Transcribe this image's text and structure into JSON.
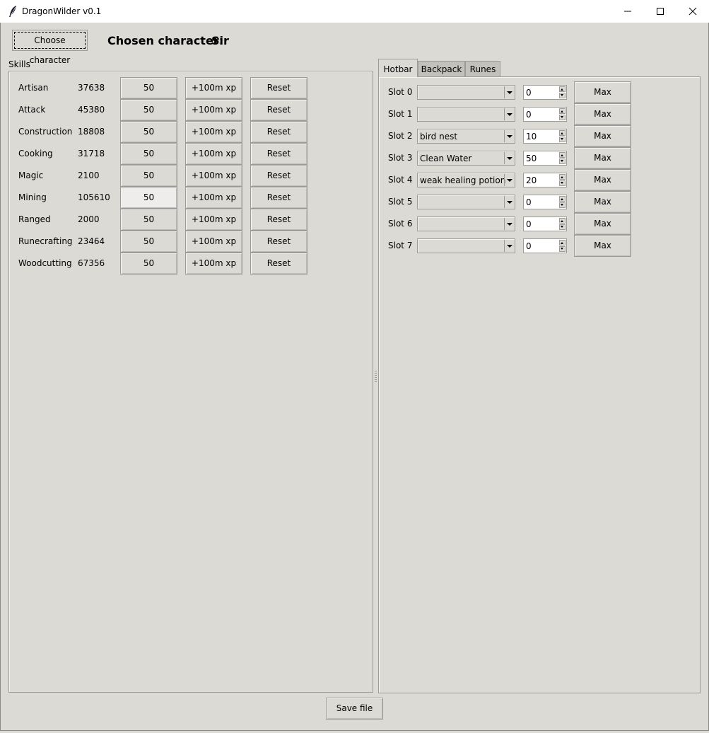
{
  "window": {
    "title": "DragonWilder v0.1",
    "app_icon": "feather-icon",
    "controls": [
      "minimize-icon",
      "maximize-icon",
      "close-icon"
    ]
  },
  "header": {
    "choose_button": "Choose character",
    "chosen_label": "Chosen character:",
    "chosen_value": "Sir"
  },
  "skills": {
    "title": "Skills",
    "rows": [
      {
        "name": "Artisan",
        "xp": "37638",
        "level": "50",
        "add_label": "+100m xp",
        "reset_label": "Reset"
      },
      {
        "name": "Attack",
        "xp": "45380",
        "level": "50",
        "add_label": "+100m xp",
        "reset_label": "Reset"
      },
      {
        "name": "Construction",
        "xp": "18808",
        "level": "50",
        "add_label": "+100m xp",
        "reset_label": "Reset"
      },
      {
        "name": "Cooking",
        "xp": "31718",
        "level": "50",
        "add_label": "+100m xp",
        "reset_label": "Reset"
      },
      {
        "name": "Magic",
        "xp": "2100",
        "level": "50",
        "add_label": "+100m xp",
        "reset_label": "Reset"
      },
      {
        "name": "Mining",
        "xp": "105610",
        "level": "50",
        "add_label": "+100m xp",
        "reset_label": "Reset"
      },
      {
        "name": "Ranged",
        "xp": "2000",
        "level": "50",
        "add_label": "+100m xp",
        "reset_label": "Reset"
      },
      {
        "name": "Runecrafting",
        "xp": "23464",
        "level": "50",
        "add_label": "+100m xp",
        "reset_label": "Reset"
      },
      {
        "name": "Woodcutting",
        "xp": "67356",
        "level": "50",
        "add_label": "+100m xp",
        "reset_label": "Reset"
      }
    ]
  },
  "tabs": [
    {
      "label": "Hotbar",
      "selected": true
    },
    {
      "label": "Backpack",
      "selected": false
    },
    {
      "label": "Runes",
      "selected": false
    }
  ],
  "hotbar": {
    "slots": [
      {
        "label": "Slot 0",
        "item": "",
        "qty": "0",
        "max_label": "Max"
      },
      {
        "label": "Slot 1",
        "item": "",
        "qty": "0",
        "max_label": "Max"
      },
      {
        "label": "Slot 2",
        "item": "bird nest",
        "qty": "10",
        "max_label": "Max"
      },
      {
        "label": "Slot 3",
        "item": "Clean Water",
        "qty": "50",
        "max_label": "Max"
      },
      {
        "label": "Slot 4",
        "item": "weak healing potion",
        "qty": "20",
        "max_label": "Max"
      },
      {
        "label": "Slot 5",
        "item": "",
        "qty": "0",
        "max_label": "Max"
      },
      {
        "label": "Slot 6",
        "item": "",
        "qty": "0",
        "max_label": "Max"
      },
      {
        "label": "Slot 7",
        "item": "",
        "qty": "0",
        "max_label": "Max"
      }
    ]
  },
  "footer": {
    "save_label": "Save file"
  }
}
